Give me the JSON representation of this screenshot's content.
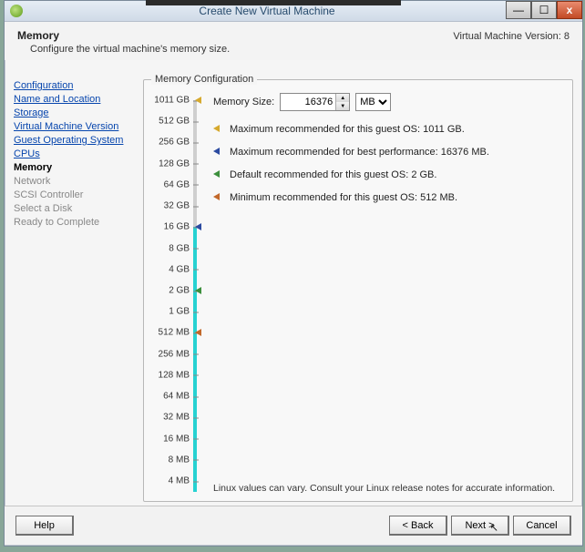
{
  "window": {
    "title": "Create New Virtual Machine"
  },
  "header": {
    "title": "Memory",
    "desc": "Configure the virtual machine's memory size.",
    "version": "Virtual Machine Version: 8"
  },
  "sidebar": {
    "steps": [
      {
        "label": "Configuration",
        "state": "done"
      },
      {
        "label": "Name and Location",
        "state": "done"
      },
      {
        "label": "Storage",
        "state": "done"
      },
      {
        "label": "Virtual Machine Version",
        "state": "done"
      },
      {
        "label": "Guest Operating System",
        "state": "done"
      },
      {
        "label": "CPUs",
        "state": "done"
      },
      {
        "label": "Memory",
        "state": "current"
      },
      {
        "label": "Network",
        "state": "future"
      },
      {
        "label": "SCSI Controller",
        "state": "future"
      },
      {
        "label": "Select a Disk",
        "state": "future"
      },
      {
        "label": "Ready to Complete",
        "state": "future"
      }
    ]
  },
  "memory": {
    "groupbox_label": "Memory Configuration",
    "size_label": "Memory Size:",
    "size_value": "16376",
    "unit": "MB",
    "ruler_ticks": [
      "1011 GB",
      "512 GB",
      "256 GB",
      "128 GB",
      "64 GB",
      "32 GB",
      "16 GB",
      "8 GB",
      "4 GB",
      "2 GB",
      "1 GB",
      "512 MB",
      "256 MB",
      "128 MB",
      "64 MB",
      "32 MB",
      "16 MB",
      "8 MB",
      "4 MB"
    ],
    "recommendations": [
      {
        "color": "yellow",
        "text": "Maximum recommended for this guest OS: 1011 GB."
      },
      {
        "color": "blue",
        "text": "Maximum recommended for best performance: 16376 MB."
      },
      {
        "color": "green",
        "text": "Default recommended for this guest OS: 2 GB."
      },
      {
        "color": "orange",
        "text": "Minimum recommended for this guest OS: 512 MB."
      }
    ],
    "footnote": "Linux values can vary. Consult your Linux release notes for accurate information."
  },
  "footer": {
    "help": "Help",
    "back": "< Back",
    "next": "Next >",
    "cancel": "Cancel"
  }
}
